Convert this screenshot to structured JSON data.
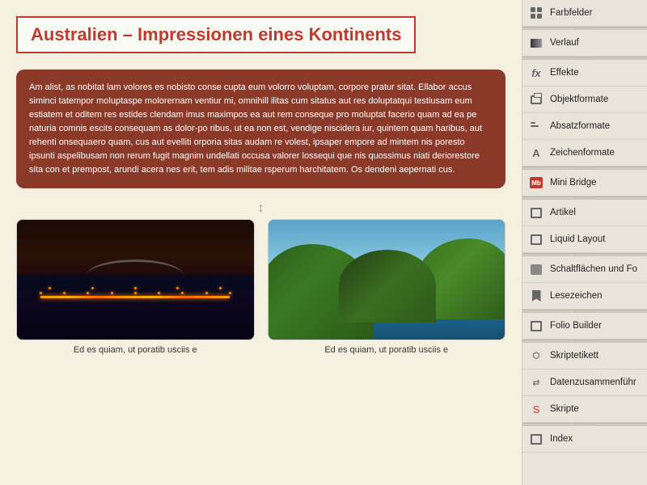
{
  "page": {
    "title": "Australien – Impressionen eines Kontinents",
    "body_text": "Am alist, as nobitat lam volores es nobisto conse cupta eum volorro voluptam, corpore pratur sitat. Ellabor accus siminci tatempor moluptaspe molorernam ventiur mi, omnihill ilitas cum sitatus aut res doluptatqui testiusam eum estiatem et oditem res estides clendam imus maximpos ea aut rem conseque pro moluptat facerio quam ad ea pe naturia comnis escits consequam as dolor-po ribus, ut ea non est, vendige niscidera iur, quintem quam haribus, aut rehenti onsequaero quam, cus aut evelliti orporia sitas audam re volest, ipsaper empore ad mintem nis poresto ipsunti aspelibusam non rerum fugit magnim undellati occusa valorer lossequi que nis quossimus niati deriorestore sita con et prempost, arundi acera nes erit, tem adis militae rsperum harchitatem. Os dendeni aepernati cus.",
    "image1_caption": "Ed es quiam, ut poratib usciis e",
    "image2_caption": "Ed es quiam, ut poratib usciis e"
  },
  "sidebar": {
    "items": [
      {
        "id": "farbfelder",
        "label": "Farbfelder",
        "icon": "grid-icon"
      },
      {
        "id": "verlauf",
        "label": "Verlauf",
        "icon": "gradient-icon"
      },
      {
        "id": "effekte",
        "label": "Effekte",
        "icon": "fx-icon"
      },
      {
        "id": "objektformate",
        "label": "Objektformate",
        "icon": "object-icon"
      },
      {
        "id": "absatzformate",
        "label": "Absatzformate",
        "icon": "paragraph-icon"
      },
      {
        "id": "zeichenformate",
        "label": "Zeichenformate",
        "icon": "character-icon"
      },
      {
        "id": "mini-bridge",
        "label": "Mini Bridge",
        "icon": "mb-icon"
      },
      {
        "id": "artikel",
        "label": "Artikel",
        "icon": "article-icon"
      },
      {
        "id": "liquid-layout",
        "label": "Liquid Layout",
        "icon": "liquid-icon"
      },
      {
        "id": "schaltflaechen",
        "label": "Schaltflächen und Fo",
        "icon": "button-icon"
      },
      {
        "id": "lesezeichen",
        "label": "Lesezeichen",
        "icon": "bookmark-icon"
      },
      {
        "id": "folio-builder",
        "label": "Folio Builder",
        "icon": "folio-icon"
      },
      {
        "id": "skriptetikett",
        "label": "Skriptetikett",
        "icon": "tag-icon"
      },
      {
        "id": "datenzusammenfuehr",
        "label": "Datenzusammenführ",
        "icon": "data-icon"
      },
      {
        "id": "skripte",
        "label": "Skripte",
        "icon": "script-icon"
      },
      {
        "id": "index",
        "label": "Index",
        "icon": "index-icon"
      }
    ]
  }
}
